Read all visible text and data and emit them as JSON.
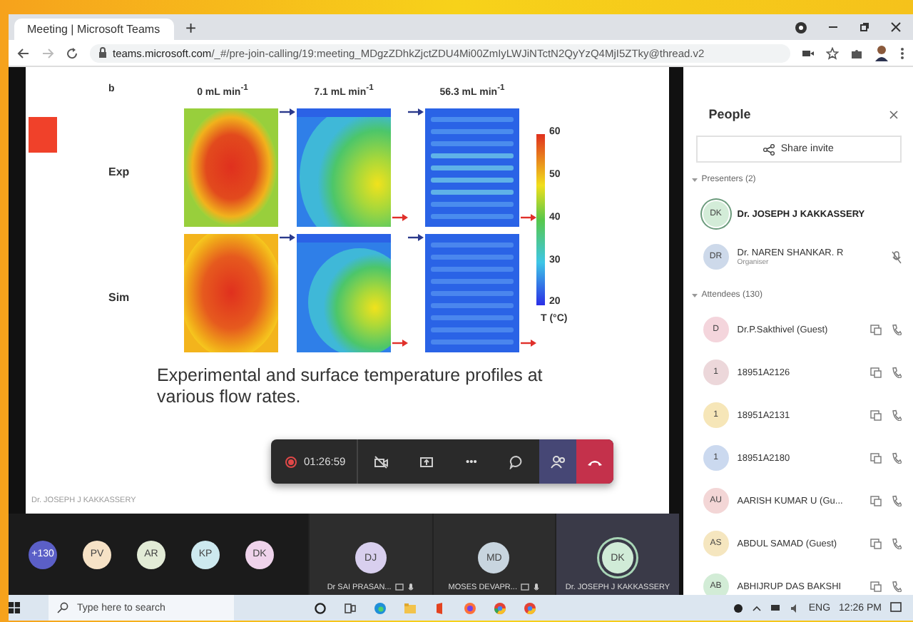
{
  "browser": {
    "tab": {
      "title": "Meeting | Microsoft Teams"
    },
    "new_tab": "+",
    "address": "**teams.microsoft.com**/_#/pre-join-calling/19:meeting_MDgzZDhkZjctZDU4Mi00ZmIyLWJiNTctN2QyYzQ4MjI5ZTky@thread.v2"
  },
  "slide": {
    "panel_letter": "b",
    "columns": [
      {
        "label": "0 mL min$^{-1}$"
      },
      {
        "label": "7.1 mL min$^{-1}$"
      },
      {
        "label": "56.3 mL min$^{-1}$"
      }
    ],
    "rows": [
      {
        "label": "Exp"
      },
      {
        "label": "Sim"
      }
    ],
    "scale": {
      "ticks": [
        "60",
        "50",
        "40",
        "30",
        "20"
      ],
      "unit": "T (°C)"
    },
    "caption": "Experimental and surface temperature profiles at various flow rates.",
    "footer": "Dr. JOSEPH J KAKKASSERY"
  },
  "call_bar": {
    "recording": true,
    "duration": "01:26:59",
    "more": "•••"
  },
  "tiles": {
    "small": [
      {
        "initials": "+130",
        "color": "#5b5fc7"
      },
      {
        "initials": "PV",
        "color": "#f6e2c6"
      },
      {
        "initials": "AR",
        "color": "#e2ebd6"
      },
      {
        "initials": "KP",
        "color": "#cde9ef"
      },
      {
        "initials": "DK",
        "color": "#efd3eb"
      }
    ],
    "video": [
      {
        "initials": "DJ",
        "name": "Dr SAI PRASAN...",
        "color": "#d8cfee",
        "speaking": false
      },
      {
        "initials": "MD",
        "name": "MOSES DEVAPR...",
        "color": "#c8d5df",
        "speaking": false
      },
      {
        "initials": "DK",
        "name": "Dr. JOSEPH J KAKKASSERY",
        "color": "#d0ebd7",
        "speaking": true
      }
    ]
  },
  "people": {
    "title": "People",
    "share": "Share invite",
    "groups": [
      {
        "title": "Presenters (2)",
        "members": [
          {
            "initials": "DK",
            "name": "Dr. JOSEPH J KAKKASSERY",
            "color": "#d3ecd8",
            "speaking": true
          },
          {
            "initials": "DR",
            "name": "Dr. NAREN SHANKAR. R",
            "role": "Organiser",
            "color": "#cdd9ea",
            "speaking": false,
            "muted": true
          }
        ]
      },
      {
        "title": "Attendees (130)",
        "members": [
          {
            "initials": "D",
            "name": "Dr.P.Sakthivel (Guest)",
            "color": "#f4d5dc",
            "speaking": false
          },
          {
            "initials": "1",
            "name": "18951A2126",
            "color": "#ecd7da",
            "speaking": false
          },
          {
            "initials": "1",
            "name": "18951A2131",
            "color": "#f6e6b8",
            "speaking": false
          },
          {
            "initials": "1",
            "name": "18951A2180",
            "color": "#cbd9ef",
            "speaking": false
          },
          {
            "initials": "AU",
            "name": "AARISH KUMAR U (Gu...",
            "color": "#f3d6d6",
            "speaking": false
          },
          {
            "initials": "AS",
            "name": "ABDUL SAMAD (Guest)",
            "color": "#f5e6bf",
            "speaking": false
          },
          {
            "initials": "AB",
            "name": "ABHIJRUP DAS BAKSHI",
            "color": "#d2ecd6",
            "speaking": false
          }
        ]
      }
    ]
  },
  "taskbar": {
    "search": {
      "placeholder": "Type here to search"
    },
    "language": "ENG",
    "time": "12:26 PM"
  }
}
